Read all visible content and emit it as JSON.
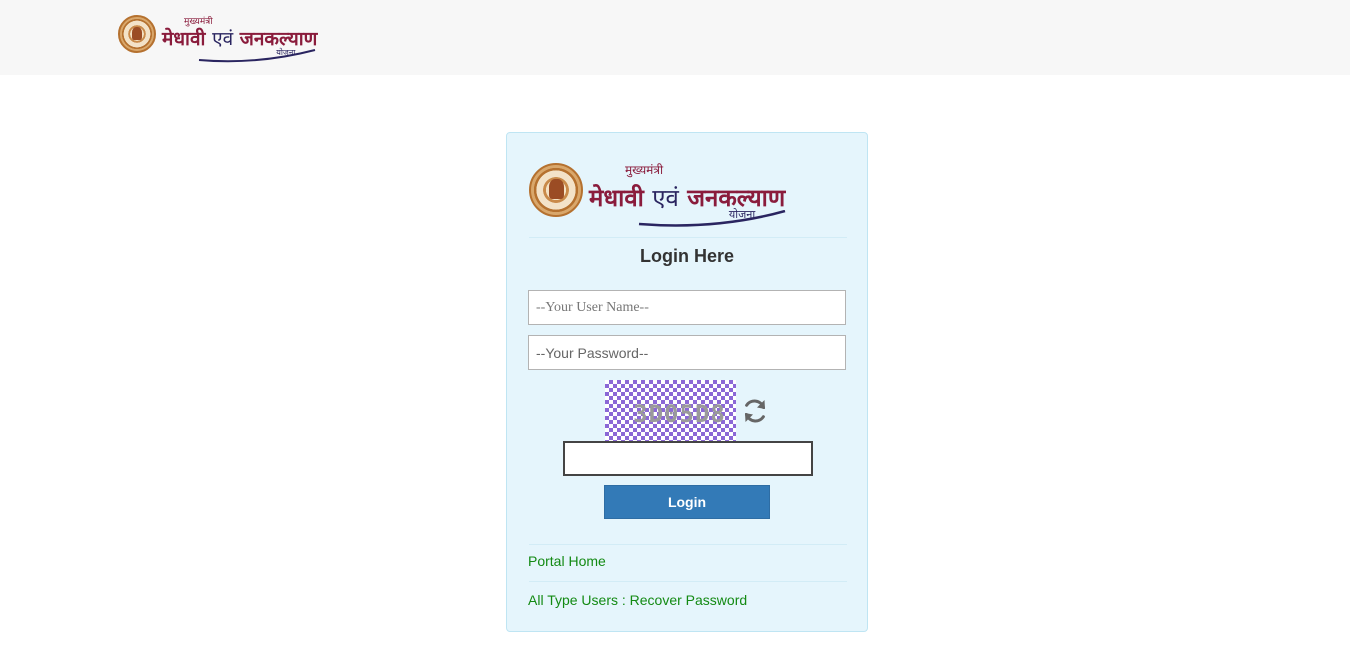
{
  "header": {
    "logo": {
      "small_top": "मुख्यमंत्री",
      "word1": "मेधावी",
      "word_mid": "एवं",
      "word2": "जनकल्याण",
      "small_bottom": "योजना"
    }
  },
  "card": {
    "logo": {
      "small_top": "मुख्यमंत्री",
      "word1": "मेधावी",
      "word_mid": "एवं",
      "word2": "जनकल्याण",
      "small_bottom": "योजना"
    },
    "title": "Login Here",
    "username_placeholder": "--Your User Name--",
    "password_placeholder": "--Your Password--",
    "captcha_text": "3D05D8",
    "captcha_value": "",
    "login_label": "Login",
    "links": {
      "portal_home": "Portal Home",
      "recover_password": "All Type Users : Recover Password"
    }
  },
  "colors": {
    "header_bg": "#f7f7f7",
    "card_bg": "#e5f5fc",
    "button_bg": "#337ab7",
    "link": "#138a13",
    "logo_maroon": "#8a1c3c",
    "logo_navy": "#2a2560"
  }
}
